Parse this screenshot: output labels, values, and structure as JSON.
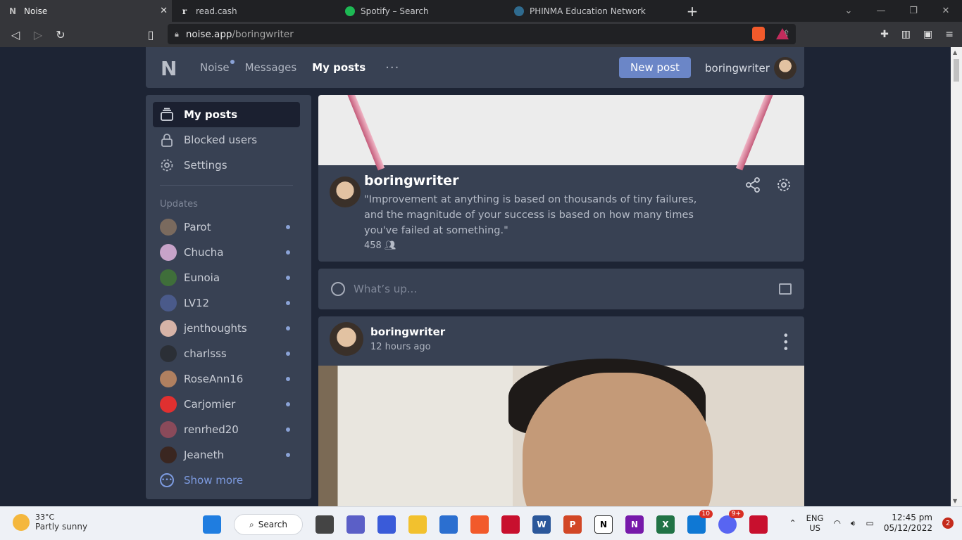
{
  "browser": {
    "tabs": [
      {
        "title": "Noise",
        "icon": "noise-icon"
      },
      {
        "title": "read.cash",
        "icon": "readcash-icon"
      },
      {
        "title": "Spotify – Search",
        "icon": "spotify-icon"
      },
      {
        "title": "PHINMA Education Network",
        "icon": "phinma-icon"
      }
    ],
    "url_host": "noise.app",
    "url_path": "/boringwriter"
  },
  "topnav": {
    "brand": "Noise",
    "messages": "Messages",
    "my_posts": "My posts",
    "more": "···",
    "new_post": "New post",
    "username": "boringwriter"
  },
  "sidebar": {
    "items": [
      {
        "label": "My posts",
        "icon": "layers-icon"
      },
      {
        "label": "Blocked users",
        "icon": "lock-icon"
      },
      {
        "label": "Settings",
        "icon": "gear-icon"
      }
    ],
    "updates_title": "Updates",
    "updates": [
      {
        "name": "Parot",
        "color": "#7a6a5e"
      },
      {
        "name": "Chucha",
        "color": "#c7a3c9"
      },
      {
        "name": "Eunoia",
        "color": "#3f6e3a"
      },
      {
        "name": "LV12",
        "color": "#4a5a8a"
      },
      {
        "name": "jenthoughts",
        "color": "#d6b3a7"
      },
      {
        "name": "charlsss",
        "color": "#2b2f36"
      },
      {
        "name": "RoseAnn16",
        "color": "#b08060"
      },
      {
        "name": "Carjomier",
        "color": "#e03030"
      },
      {
        "name": "renrhed20",
        "color": "#8a4a5a"
      },
      {
        "name": "Jeaneth",
        "color": "#3a2620"
      }
    ],
    "show_more": "Show more"
  },
  "profile": {
    "name": "boringwriter",
    "quote": "\"Improvement at anything is based on thousands of tiny failures, and the magnitude of your success is based on how many times you've failed at something.\"",
    "followers": "458"
  },
  "composer": {
    "placeholder": "What’s up..."
  },
  "post": {
    "author": "boringwriter",
    "time": "12 hours ago"
  },
  "taskbar": {
    "temp": "33°C",
    "weather": "Partly sunny",
    "search": "Search",
    "badge_teams": "10",
    "badge_discord": "9+",
    "lang1": "ENG",
    "lang2": "US",
    "time": "12:45 pm",
    "date": "05/12/2022",
    "notifications": "2"
  }
}
